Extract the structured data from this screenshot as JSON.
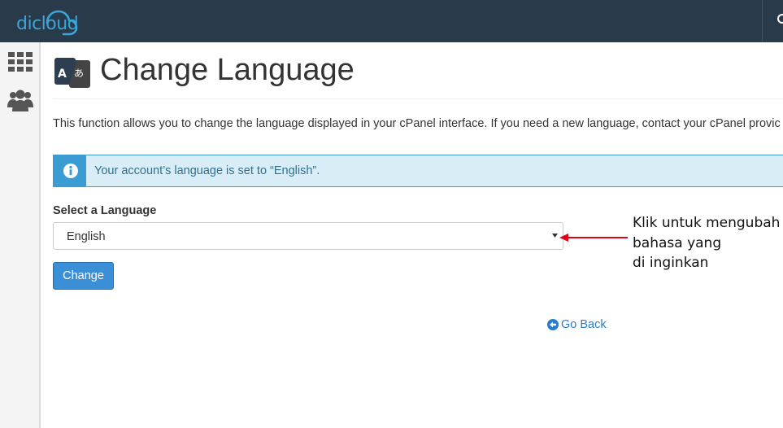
{
  "topbar": {
    "logo_text": "dicloud",
    "brand_color": "#3ba5d8",
    "search_icon": "search-icon"
  },
  "sidebar": {
    "items": [
      {
        "icon": "grid-icon"
      },
      {
        "icon": "users-icon"
      }
    ]
  },
  "page": {
    "title": "Change Language",
    "title_icon": "language-icon",
    "description": "This function allows you to change the language displayed in your cPanel interface. If you need a new language, contact your cPanel provic"
  },
  "alert": {
    "icon": "info-icon",
    "text": "Your account’s language is set to “English”."
  },
  "form": {
    "select_label": "Select a Language",
    "select_value": "English",
    "submit_label": "Change"
  },
  "go_back": {
    "label": "Go Back",
    "icon": "arrow-left-circle-icon"
  },
  "annotation": {
    "text": "Klik untuk mengubah\nbahasa yang\ndi inginkan",
    "arrow_color": "#e3001b"
  }
}
